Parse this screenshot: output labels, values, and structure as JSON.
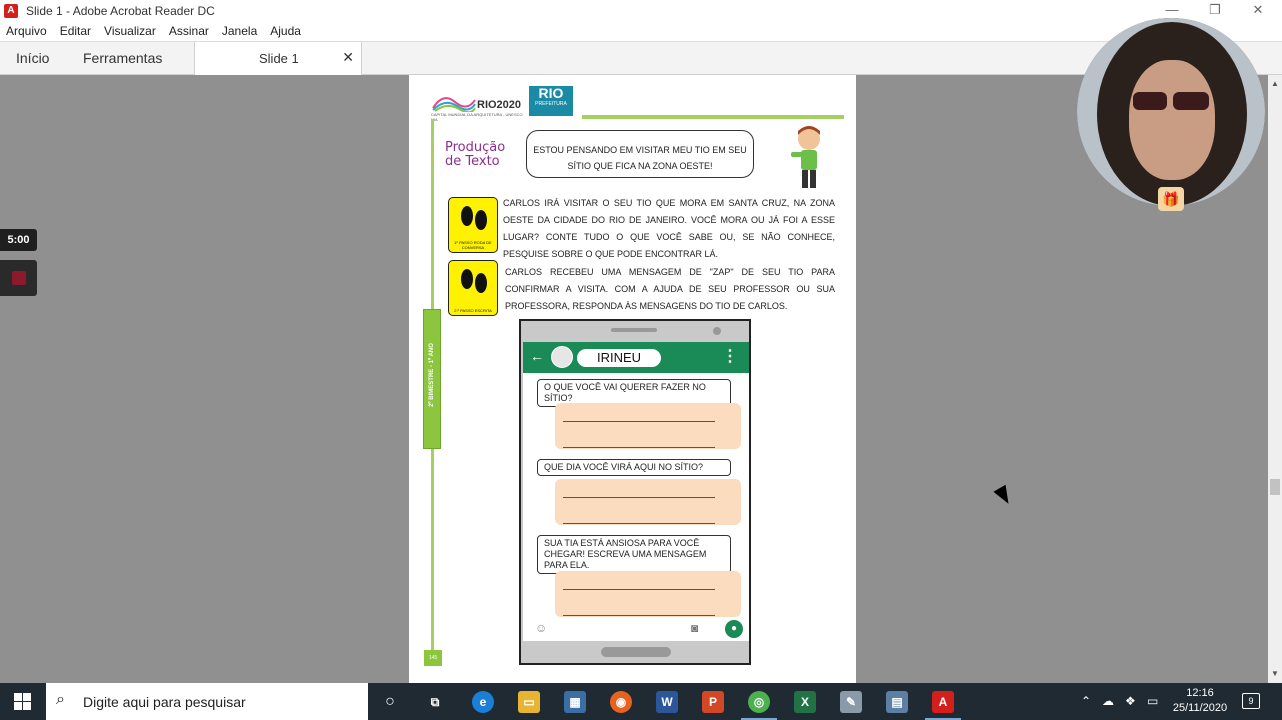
{
  "window": {
    "title": "Slide 1 - Adobe Acrobat Reader DC"
  },
  "menu": [
    "Arquivo",
    "Editar",
    "Visualizar",
    "Assinar",
    "Janela",
    "Ajuda"
  ],
  "tabs": {
    "home": "Início",
    "tools": "Ferramentas",
    "document": "Slide 1"
  },
  "timer": "5:00",
  "document": {
    "logo_rio": "RIO2020",
    "logo_rio_sub": "CAPITAL MUNDIAL DA ARQUITETURA - UNESCO UIA",
    "logo_pref": "RIO",
    "logo_pref_sub": "PREFEITURA",
    "section_title": "Produção de Texto",
    "speech": "ESTOU PENSANDO EM VISITAR MEU TIO EM SEU SÍTIO QUE FICA NA ZONA OESTE!",
    "step1_label": "1º PASSO RODA DE CONVERSA",
    "step2_label": "2.º PASSO ESCRITA",
    "para1": "CARLOS IRÁ VISITAR O SEU TIO QUE MORA EM SANTA CRUZ, NA ZONA OESTE DA CIDADE DO RIO DE JANEIRO. VOCÊ MORA OU JÁ FOI A ESSE LUGAR? CONTE TUDO O QUE VOCÊ SABE OU, SE NÃO CONHECE, PESQUISE SOBRE O QUE PODE ENCONTRAR LÁ.",
    "para2": "CARLOS RECEBEU UMA MENSAGEM DE \"ZAP\" DE SEU TIO PARA CONFIRMAR A VISITA. COM A AJUDA DE SEU PROFESSOR OU SUA PROFESSORA, RESPONDA ÀS MENSAGENS DO TIO DE CARLOS.",
    "side_label": "2º BIMESTRE - 1º ANO",
    "page_number": "145",
    "chat": {
      "contact": "IRINEU",
      "q1": "O QUE VOCÊ VAI QUERER FAZER NO SÍTIO?",
      "q2": "QUE DIA VOCÊ VIRÁ AQUI NO SÍTIO?",
      "q3": "SUA TIA ESTÁ ANSIOSA PARA VOCÊ CHEGAR! ESCREVA UMA MENSAGEM PARA ELA."
    }
  },
  "taskbar": {
    "search_placeholder": "Digite aqui para pesquisar",
    "time": "12:16",
    "date": "25/11/2020",
    "notifications": "9"
  }
}
